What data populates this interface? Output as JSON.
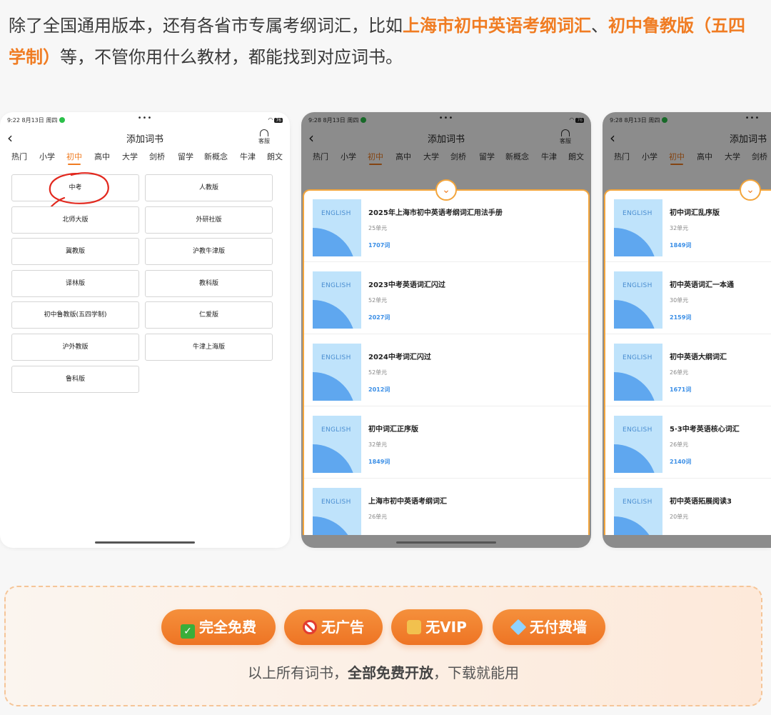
{
  "intro": {
    "part1": "除了全国通用版本，还有各省市专属考纲词汇，比如",
    "highlight1": "上海市初中英语考纲词汇",
    "sep": "、",
    "highlight2": "初中鲁教版（五四学制）",
    "part2": "等，不管你用什么教材，都能找到对应词书。"
  },
  "screens": [
    {
      "status_time": "9:22  8月13日 周四",
      "battery": "76",
      "nav_title": "添加词书",
      "service_label": "客服",
      "tabs": [
        "热门",
        "小学",
        "初中",
        "高中",
        "大学",
        "剑桥",
        "留学",
        "新概念",
        "牛津",
        "朗文"
      ],
      "active_tab": "初中",
      "buttons": [
        "中考",
        "人教版",
        "北师大版",
        "外研社版",
        "冀教版",
        "沪教牛津版",
        "译林版",
        "教科版",
        "初中鲁教版(五四学制)",
        "仁爱版",
        "沪外教版",
        "牛津上海版",
        "鲁科版"
      ]
    },
    {
      "status_time": "9:28  8月13日 周四",
      "battery": "76",
      "nav_title": "添加词书",
      "service_label": "客服",
      "tabs": [
        "热门",
        "小学",
        "初中",
        "高中",
        "大学",
        "剑桥",
        "留学",
        "新概念",
        "牛津",
        "朗文"
      ],
      "active_tab": "初中",
      "books": [
        {
          "name": "2025年上海市初中英语考纲词汇用法手册",
          "units": "25单元",
          "words": "1707词"
        },
        {
          "name": "2023中考英语词汇闪过",
          "units": "52单元",
          "words": "2027词"
        },
        {
          "name": "2024中考词汇闪过",
          "units": "52单元",
          "words": "2012词"
        },
        {
          "name": "初中词汇正序版",
          "units": "32单元",
          "words": "1849词"
        },
        {
          "name": "上海市初中英语考纲词汇",
          "units": "26单元",
          "words": ""
        }
      ]
    },
    {
      "status_time": "9:28  8月13日 周四",
      "nav_title": "添加词书",
      "tabs": [
        "热门",
        "小学",
        "初中",
        "高中",
        "大学",
        "剑桥"
      ],
      "active_tab": "初中",
      "books": [
        {
          "name": "初中词汇乱序版",
          "units": "32单元",
          "words": "1849词"
        },
        {
          "name": "初中英语词汇一本通",
          "units": "30单元",
          "words": "2159词"
        },
        {
          "name": "初中英语大纲词汇",
          "units": "26单元",
          "words": "1671词"
        },
        {
          "name": "5·3中考英语核心词汇",
          "units": "26单元",
          "words": "2140词"
        },
        {
          "name": "初中英语拓展阅读3",
          "units": "20单元",
          "words": ""
        }
      ]
    }
  ],
  "cover_label": "ENGLISH",
  "promo": {
    "badges": [
      {
        "icon": "check-icon",
        "label": "完全免费"
      },
      {
        "icon": "no-entry-icon",
        "label": "无广告"
      },
      {
        "icon": "lock-icon",
        "label": "无VIP"
      },
      {
        "icon": "gem-icon",
        "label": "无付费墙"
      }
    ],
    "text_pre": "以上所有词书，",
    "text_bold": "全部免费开放",
    "text_post": "，下载就能用"
  }
}
